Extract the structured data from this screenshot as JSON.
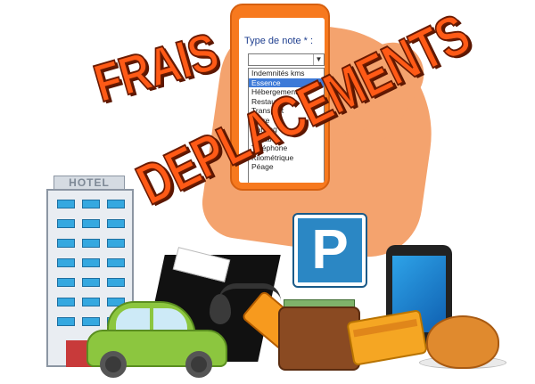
{
  "title": {
    "line1": "FRAIS",
    "line2": "DEPLACEMENTS"
  },
  "phone": {
    "field_label": "Type de note * :",
    "selected_value": "",
    "options": [
      "Indemnités kms",
      "Essence",
      "Hébergement",
      "Restauration",
      "Transport",
      "Autre",
      "Parking",
      "Location",
      "Téléphone",
      "Kilométrique",
      "Péage"
    ],
    "highlighted_option": "Essence"
  },
  "hotel": {
    "sign": "HOTEL"
  },
  "parking": {
    "letter": "P"
  },
  "colors": {
    "title_fill": "#ff5a16",
    "title_outline": "#6a1a00",
    "phone_case": "#f7791e",
    "parking_blue": "#2b87c4",
    "car_green": "#8cc63f",
    "selection_blue": "#3d7ad8"
  },
  "icons": [
    "hotel-building-icon",
    "parking-sign-icon",
    "smartphone-icon",
    "car-icon",
    "fuel-nozzle-icon",
    "oil-drop-icon",
    "wallet-icon",
    "credit-card-icon",
    "roast-chicken-icon"
  ]
}
